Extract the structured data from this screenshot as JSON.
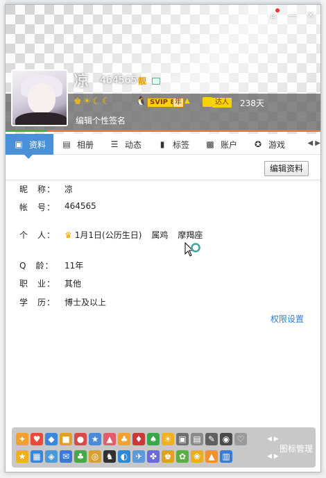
{
  "window": {
    "nickname": "凉",
    "uin": "464565",
    "liang_badge": "靓",
    "vip_label": "SVIP 8",
    "vip_year": "年",
    "daren_label": "达人",
    "days": "238天",
    "signature": "编辑个性签名"
  },
  "tabs": [
    {
      "label": "资料",
      "icon": "profile-card-icon"
    },
    {
      "label": "相册",
      "icon": "album-icon"
    },
    {
      "label": "动态",
      "icon": "feed-icon"
    },
    {
      "label": "标签",
      "icon": "tag-icon"
    },
    {
      "label": "账户",
      "icon": "wallet-icon"
    },
    {
      "label": "游戏",
      "icon": "game-icon"
    }
  ],
  "profile": {
    "edit_button": "编辑资料",
    "nickname_label": "昵　称：",
    "nickname_value": "凉",
    "account_label": "帐　号：",
    "account_value": "464565",
    "personal_label": "个　人：",
    "birthday": "1月1日(公历生日)",
    "zodiac": "属鸡",
    "constellation": "摩羯座",
    "qage_label": "Q　龄：",
    "qage_value": "11年",
    "job_label": "职　业：",
    "job_value": "其他",
    "edu_label": "学　历：",
    "edu_value": "博士及以上",
    "permission_link": "权限设置"
  },
  "iconbar": {
    "manage_label": "图标管理"
  },
  "colors": {
    "accent_blue": "#4a90d9",
    "link_blue": "#2f7bd6",
    "header_orange": "#e8772b",
    "vip_gold": "#f5d20a"
  }
}
